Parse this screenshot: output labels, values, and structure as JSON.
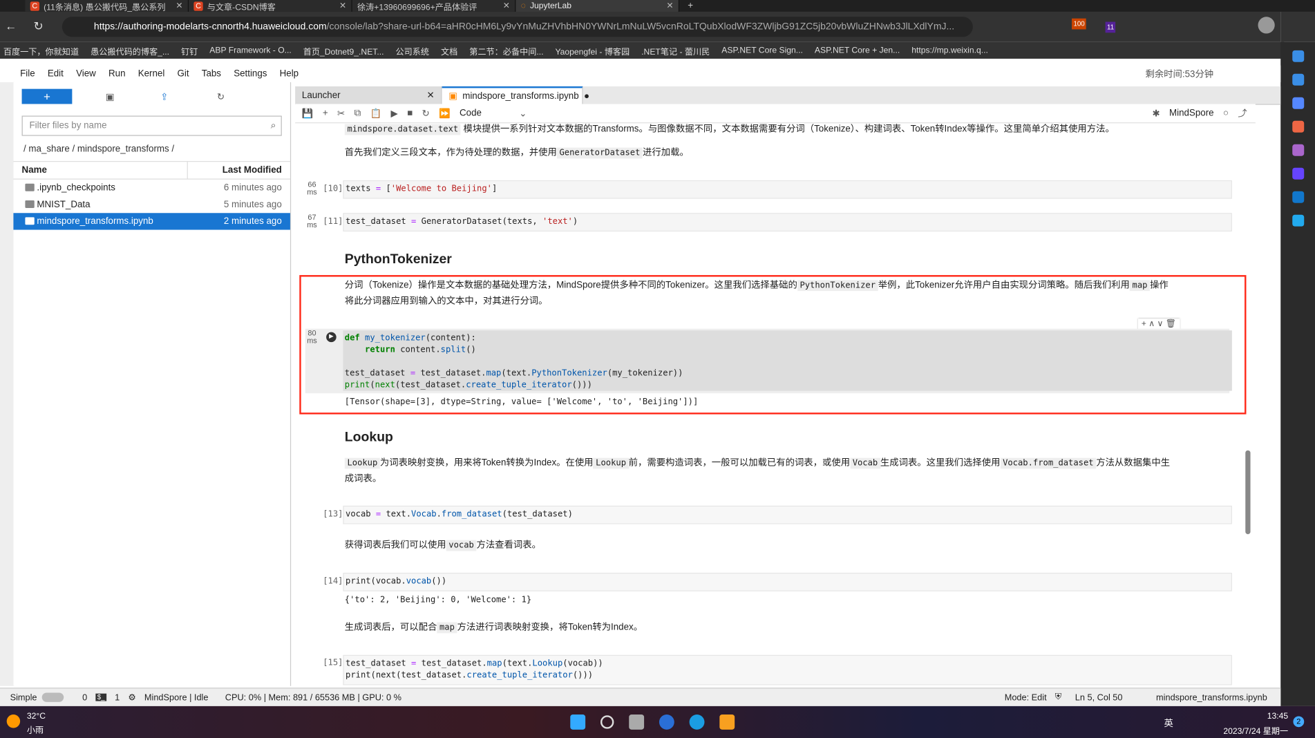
{
  "browser": {
    "tabs": [
      {
        "label": "(11条消息) 愚公搬代码_愚公系列"
      },
      {
        "label": "与文章-CSDN博客"
      },
      {
        "label": "徐涛+13960699696+产品体验评"
      },
      {
        "label": "JupyterLab"
      }
    ],
    "url_host": "https://authoring-modelarts-cnnorth4.huaweicloud.com",
    "url_rest": "/console/lab?share-url-b64=aHR0cHM6Ly9vYnMuZHVhbHN0YWNrLmNuLW5vcnRoLTQubXlodWF3ZWljbG91ZC5jb20vbWluZHNwb3JlLXdlYmJ...",
    "badges": [
      "100",
      "11"
    ],
    "bookmarks": [
      "百度一下，你就知道",
      "愚公搬代码的博客_...",
      "钉钉",
      "ABP Framework - O...",
      "首页_Dotnet9_.NET...",
      "公司系统",
      "文档",
      "第二节：必备中间...",
      "Yaopengfei - 博客园",
      ".NET笔记 - 蕾川民",
      "ASP.NET Core Sign...",
      "ASP.NET Core + Jen...",
      "https://mp.weixin.q..."
    ]
  },
  "menu": {
    "items": [
      "File",
      "Edit",
      "View",
      "Run",
      "Kernel",
      "Git",
      "Tabs",
      "Settings",
      "Help"
    ],
    "timer": "剩余时间:53分钟"
  },
  "filebrowser": {
    "filter_placeholder": "Filter files by name",
    "breadcrumb": "/ ma_share / mindspore_transforms /",
    "col_name": "Name",
    "col_modified": "Last Modified",
    "files": [
      {
        "name": ".ipynb_checkpoints",
        "modified": "6 minutes ago"
      },
      {
        "name": "MNIST_Data",
        "modified": "5 minutes ago"
      },
      {
        "name": "mindspore_transforms.ipynb",
        "modified": "2 minutes ago"
      }
    ]
  },
  "notebook": {
    "tabs": [
      {
        "label": "Launcher"
      },
      {
        "label": "mindspore_transforms.ipynb"
      }
    ],
    "cell_type": "Code",
    "kernel": "MindSpore",
    "md1_code": "mindspore.dataset.text",
    "md1_text": "模块提供一系列针对文本数据的Transforms。与图像数据不同，文本数据需要有分词（Tokenize）、构建词表、Token转Index等操作。这里简单介绍其使用方法。",
    "md2_a": "首先我们定义三段文本，作为待处理的数据，并使用",
    "md2_code": "GeneratorDataset",
    "md2_b": "进行加载。",
    "c10": {
      "prompt": "[10]",
      "time": "66",
      "unit": "ms"
    },
    "c11": {
      "prompt": "[11]",
      "time": "67",
      "unit": "ms"
    },
    "h_tok": "PythonTokenizer",
    "tok_a": "分词（Tokenize）操作是文本数据的基础处理方法，MindSpore提供多种不同的Tokenizer。这里我们选择基础的",
    "tok_code": "PythonTokenizer",
    "tok_b": "举例，此Tokenizer允许用户自由实现分词策略。随后我们利用",
    "tok_code2": "map",
    "tok_c": "操作",
    "tok_line2": "将此分词器应用到输入的文本中，对其进行分词。",
    "c12": {
      "time": "80",
      "unit": "ms"
    },
    "out12": "[Tensor(shape=[3], dtype=String, value= ['Welcome', 'to', 'Beijing'])]",
    "h_look": "Lookup",
    "lk_c1": "Lookup",
    "lk_a": "为词表映射变换，用来将Token转换为Index。在使用",
    "lk_c2": "Lookup",
    "lk_b": "前，需要构造词表，一般可以加载已有的词表，或使用",
    "lk_c3": "Vocab",
    "lk_c": "生成词表。这里我们选择使用",
    "lk_c4": "Vocab.from_dataset",
    "lk_d": "方法从数据集中生",
    "lk_line2": "成词表。",
    "c13": {
      "prompt": "[13]"
    },
    "md3_a": "获得词表后我们可以使用",
    "md3_code": "vocab",
    "md3_b": "方法查看词表。",
    "c14": {
      "prompt": "[14]"
    },
    "out14": "{'to': 2, 'Beijing': 0, 'Welcome': 1}",
    "md4_a": "生成词表后，可以配合",
    "md4_code": "map",
    "md4_b": "方法进行词表映射变换，将Token转为Index。",
    "c15": {
      "prompt": "[15]"
    }
  },
  "statusbar": {
    "mode_label": "Simple",
    "n0": "0",
    "n1": "1",
    "kernel_status": "MindSpore | Idle",
    "resources": "CPU: 0% | Mem: 891 / 65536 MB | GPU: 0 %",
    "mode": "Mode: Edit",
    "cursor": "Ln 5, Col 50",
    "file": "mindspore_transforms.ipynb"
  },
  "taskbar": {
    "temp": "32°C",
    "weather": "小雨",
    "ime": "英",
    "time": "13:45",
    "date": "2023/7/24 星期一",
    "notif": "2"
  },
  "colors": {
    "accent": "#1976d2",
    "highlight_box": "#ff2a1a"
  }
}
